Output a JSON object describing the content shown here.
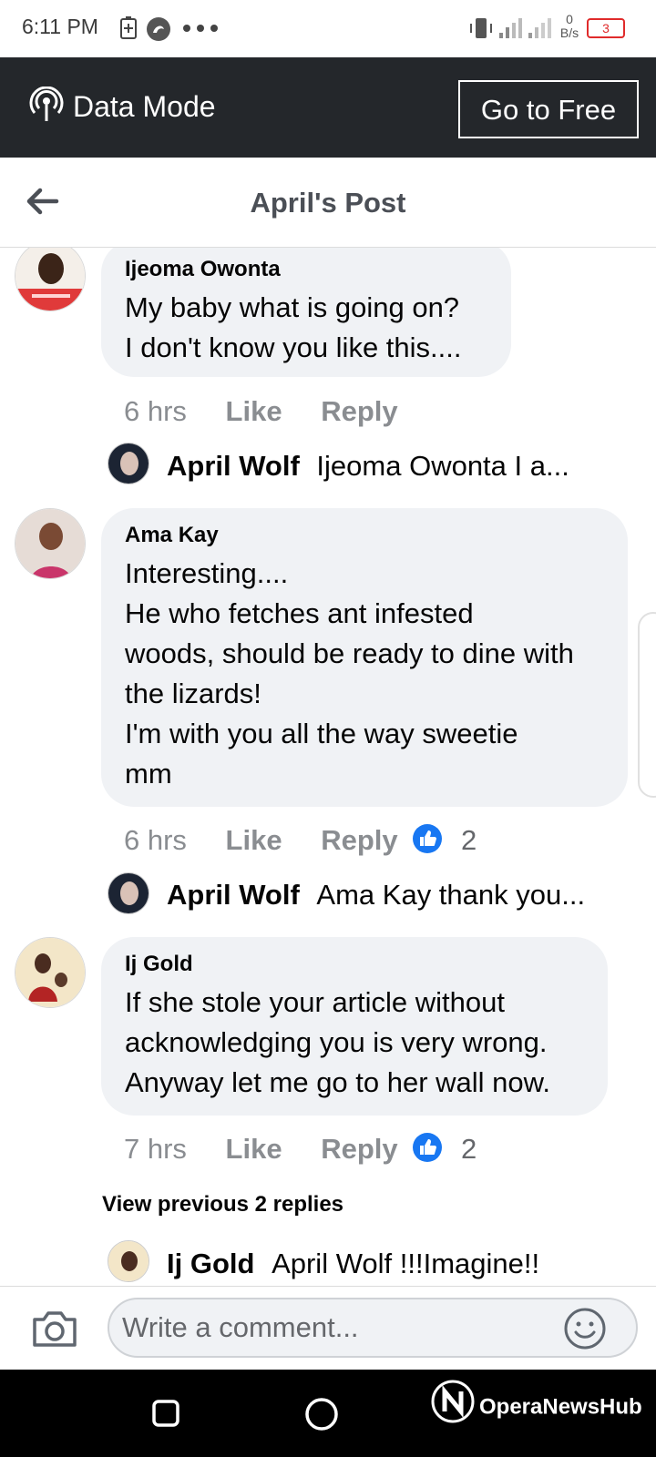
{
  "status_bar": {
    "time": "6:11 PM",
    "speed_value": "0",
    "speed_unit": "B/s",
    "notification_count": "3"
  },
  "data_mode": {
    "label": "Data Mode",
    "go_free_label": "Go to Free"
  },
  "header": {
    "title": "April's Post"
  },
  "comments": [
    {
      "author": "Ijeoma Owonta",
      "lines": [
        "My baby what is going on?",
        "I don't know you like this...."
      ],
      "time": "6 hrs",
      "like_label": "Like",
      "reply_label": "Reply",
      "reply_preview": {
        "author": "April Wolf",
        "text": "Ijeoma Owonta I a..."
      }
    },
    {
      "author": "Ama Kay",
      "lines": [
        "Interesting....",
        "He who fetches ant infested",
        "woods, should be ready to dine with",
        "the lizards!",
        "I'm with you all the way sweetie",
        "mm"
      ],
      "time": "6 hrs",
      "like_label": "Like",
      "reply_label": "Reply",
      "reaction_count": "2",
      "reply_preview": {
        "author": "April Wolf",
        "text": "Ama Kay thank you..."
      }
    },
    {
      "author": "Ij Gold",
      "lines": [
        "If she stole your article without",
        "acknowledging you is very wrong.",
        "Anyway let me go to her wall now."
      ],
      "time": "7 hrs",
      "like_label": "Like",
      "reply_label": "Reply",
      "reaction_count": "2",
      "view_previous_label": "View previous 2 replies",
      "reply_preview": {
        "author": "Ij Gold",
        "text": "April Wolf !!!Imagine!!"
      }
    }
  ],
  "composer": {
    "placeholder": "Write a comment..."
  },
  "watermark": "OperaNewsHub",
  "colors": {
    "data_bar": "#24272b",
    "bubble": "#f0f2f5",
    "like_blue": "#1877f2",
    "muted": "#8a8d91"
  }
}
